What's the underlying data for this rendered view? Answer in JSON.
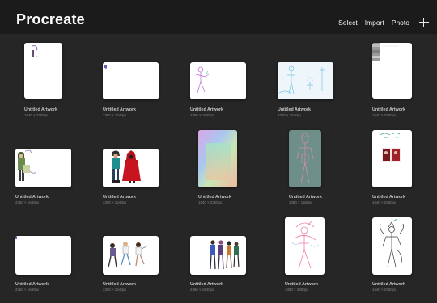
{
  "app": {
    "title": "Procreate"
  },
  "toolbar": {
    "select_label": "Select",
    "import_label": "Import",
    "photo_label": "Photo",
    "add_icon": "plus-icon"
  },
  "artworks": [
    {
      "name": "Untitled Artwork",
      "size": "1640 × 2360px",
      "preview": "sketch-doodle-corner"
    },
    {
      "name": "Untitled Artwork",
      "size": "2360 × 1640px",
      "preview": "small-purple-mark"
    },
    {
      "name": "Untitled Artwork",
      "size": "2360 × 1640px",
      "preview": "purple-figure-sketch"
    },
    {
      "name": "Untitled Artwork",
      "size": "2360 × 1640px",
      "preview": "blue-line-sketches"
    },
    {
      "name": "Untitled Artwork",
      "size": "1640 × 2360px",
      "preview": "gray-swatch-corner"
    },
    {
      "name": "Untitled Artwork",
      "size": "2360 × 1640px",
      "preview": "green-characters"
    },
    {
      "name": "Untitled Artwork",
      "size": "2360 × 1640px",
      "preview": "teal-and-red-characters"
    },
    {
      "name": "Untitled Artwork",
      "size": "1640 × 2360px",
      "preview": "pastel-gradient"
    },
    {
      "name": "Untitled Artwork",
      "size": "1080 × 1920px",
      "preview": "teal-figure-sketch"
    },
    {
      "name": "Untitled Artwork",
      "size": "1640 × 2360px",
      "preview": "green-doodle-with-photo"
    },
    {
      "name": "Untitled Artwork",
      "size": "2360 × 1640px",
      "preview": "blank-with-mark"
    },
    {
      "name": "Untitled Artwork",
      "size": "2360 × 1640px",
      "preview": "three-characters"
    },
    {
      "name": "Untitled Artwork",
      "size": "2360 × 1640px",
      "preview": "character-lineup"
    },
    {
      "name": "Untitled Artwork",
      "size": "1080 × 2360px",
      "preview": "pink-figure-sketch"
    },
    {
      "name": "Untitled Artwork",
      "size": "1640 × 2360px",
      "preview": "dragon-figure-sketch"
    }
  ]
}
